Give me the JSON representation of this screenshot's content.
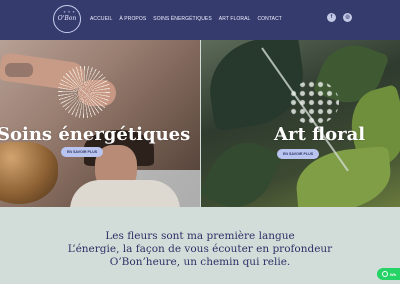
{
  "header": {
    "logo_text": "O'Bon",
    "nav": [
      "ACCUEIL",
      "À PROPOS",
      "SOINS ÉNERGÉTIQUES",
      "ART FLORAL",
      "CONTACT"
    ],
    "social": [
      {
        "icon": "facebook-icon",
        "glyph": "f"
      },
      {
        "icon": "instagram-icon",
        "glyph": "◎"
      }
    ]
  },
  "panels": [
    {
      "title": "Soins énergétiques",
      "button": "EN SAVOIR PLUS"
    },
    {
      "title": "Art floral",
      "button": "EN SAVOIR PLUS"
    }
  ],
  "tagline": [
    "Les fleurs sont ma première langue",
    "L’énergie, la façon de vous écouter en profondeur",
    "O’Bon’heure, un chemin qui relie."
  ],
  "whatsapp": {
    "label": "Wh"
  },
  "colors": {
    "header": "#363b6e",
    "button": "#b9c4ef",
    "background": "#d2ddd9",
    "whatsapp": "#25d366"
  }
}
